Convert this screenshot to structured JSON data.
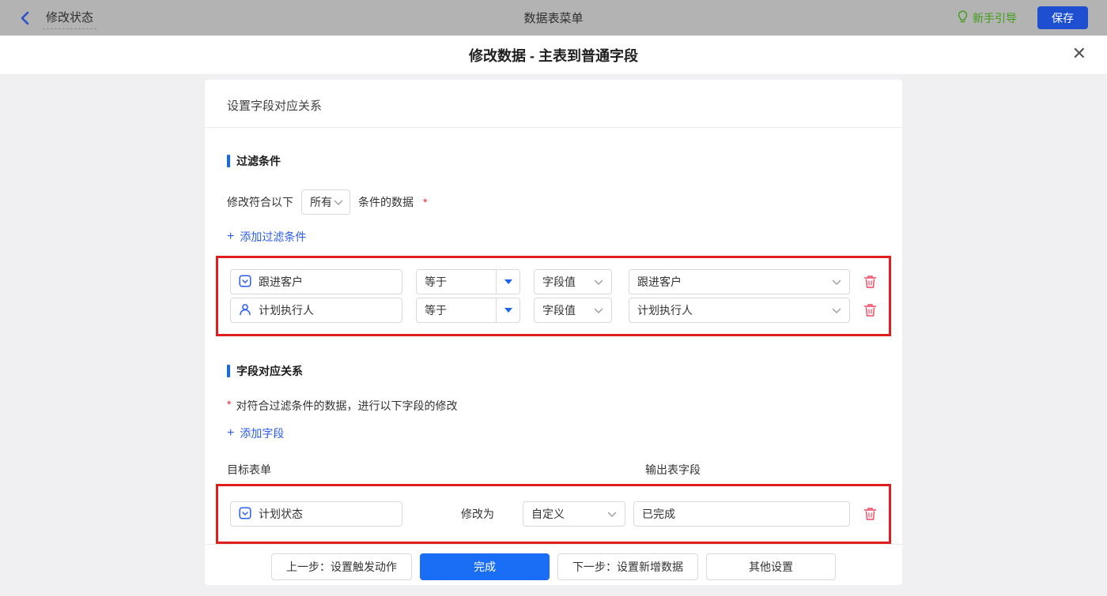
{
  "topbar": {
    "flow_title": "修改状态",
    "center_title": "数据表菜单",
    "guide_label": "新手引导",
    "save_label": "保存"
  },
  "modal": {
    "title": "修改数据 - 主表到普通字段",
    "close_glyph": "✕"
  },
  "card": {
    "header": "设置字段对应关系",
    "filter": {
      "title": "过滤条件",
      "match_prefix": "修改符合以下",
      "match_mode": "所有",
      "match_suffix": "条件的数据",
      "required_mark": "*",
      "add_plus": "+",
      "add_label": "添加过滤条件",
      "rows": [
        {
          "field_icon": "select-field-icon",
          "field": "跟进客户",
          "operator": "等于",
          "value_type": "字段值",
          "value": "跟进客户"
        },
        {
          "field_icon": "user-field-icon",
          "field": "计划执行人",
          "operator": "等于",
          "value_type": "字段值",
          "value": "计划执行人"
        }
      ]
    },
    "mapping": {
      "title": "字段对应关系",
      "required_mark": "*",
      "description": "对符合过滤条件的数据，进行以下字段的修改",
      "add_plus": "+",
      "add_label": "添加字段",
      "col_left": "目标表单",
      "col_right": "输出表字段",
      "rows": [
        {
          "field_icon": "select-field-icon",
          "field": "计划状态",
          "middle_label": "修改为",
          "mode": "自定义",
          "value": "已完成"
        }
      ]
    },
    "footer": {
      "prev_label": "上一步：设置触发动作",
      "done_label": "完成",
      "next_label": "下一步：设置新增数据",
      "other_label": "其他设置"
    }
  },
  "colors": {
    "accent_blue": "#2b5cf6",
    "primary_blue": "#1a6ef5",
    "save_blue": "#1d4fd0",
    "guide_green": "#3f9d15",
    "highlight_red": "#e01e1e",
    "trash_red": "#f5455f",
    "topbar_bg": "#b3b3b4",
    "page_bg": "#f0f0f2"
  }
}
